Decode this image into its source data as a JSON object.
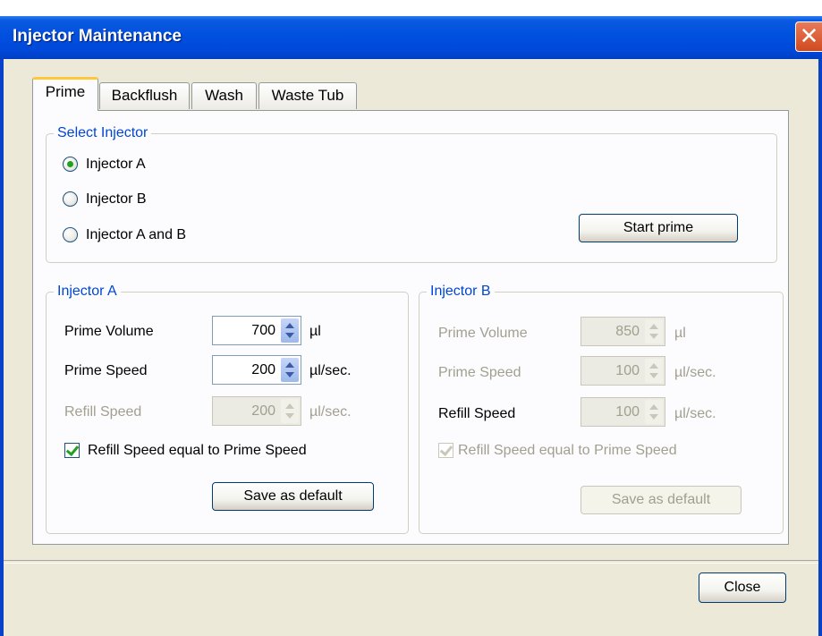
{
  "window": {
    "title": "Injector Maintenance",
    "close_glyph": "✕"
  },
  "tabs": [
    {
      "label": "Prime",
      "active": true
    },
    {
      "label": "Backflush",
      "active": false
    },
    {
      "label": "Wash",
      "active": false
    },
    {
      "label": "Waste Tub",
      "active": false
    }
  ],
  "select_injector": {
    "legend": "Select Injector",
    "options": [
      {
        "label": "Injector A",
        "selected": true
      },
      {
        "label": "Injector B",
        "selected": false
      },
      {
        "label": "Injector A and B",
        "selected": false
      }
    ],
    "start_button": "Start prime"
  },
  "injector_a": {
    "legend": "Injector A",
    "prime_volume": {
      "label": "Prime Volume",
      "value": "700",
      "unit": "µl"
    },
    "prime_speed": {
      "label": "Prime Speed",
      "value": "200",
      "unit": "µl/sec."
    },
    "refill_speed": {
      "label": "Refill Speed",
      "value": "200",
      "unit": "µl/sec."
    },
    "refill_equal": {
      "label": "Refill Speed equal to Prime Speed",
      "checked": true
    },
    "save_button": "Save as default"
  },
  "injector_b": {
    "legend": "Injector B",
    "prime_volume": {
      "label": "Prime Volume",
      "value": "850",
      "unit": "µl"
    },
    "prime_speed": {
      "label": "Prime Speed",
      "value": "100",
      "unit": "µl/sec."
    },
    "refill_speed": {
      "label": "Refill Speed",
      "value": "100",
      "unit": "µl/sec."
    },
    "refill_equal": {
      "label": "Refill Speed equal to Prime Speed",
      "checked": true
    },
    "save_button": "Save as default"
  },
  "footer": {
    "close_button": "Close"
  },
  "colors": {
    "titlebar": "#0050e0",
    "legend_text": "#0046d5",
    "dialog_bg": "#ece9d8",
    "check_green": "#21a121",
    "disabled_text": "#a19f8e"
  },
  "icons": {
    "close": "close-icon",
    "spin_up": "chevron-up-icon",
    "spin_down": "chevron-down-icon",
    "radio_dot": "radio-selected-icon",
    "check": "checkmark-icon"
  }
}
